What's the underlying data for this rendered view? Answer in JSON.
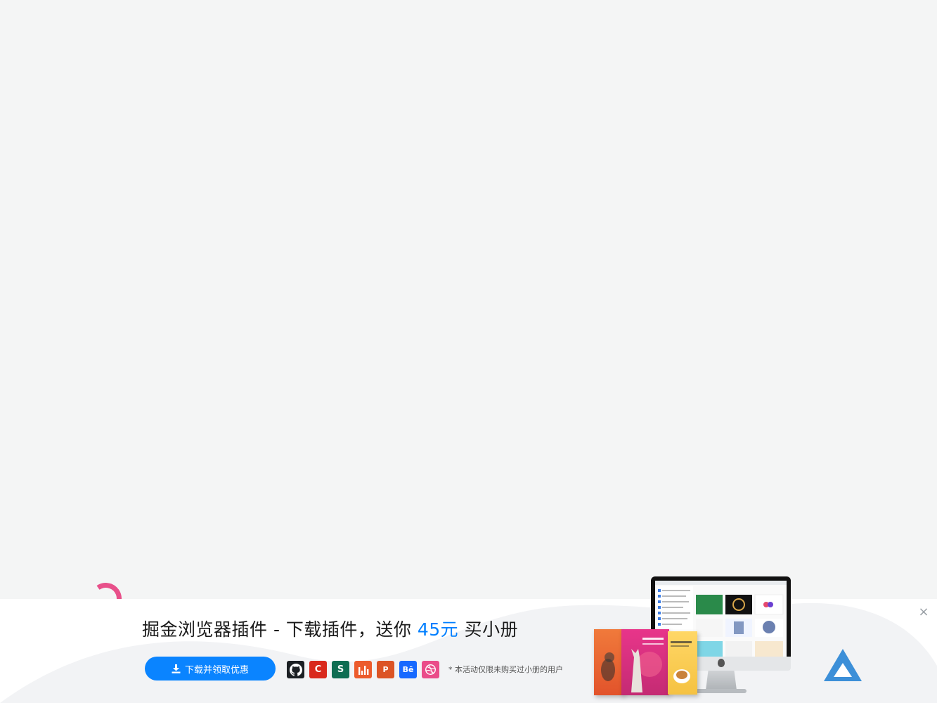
{
  "banner": {
    "headline_prefix": "掘金浏览器插件 - 下载插件，送你 ",
    "headline_amount": "45元",
    "headline_suffix": " 买小册",
    "download_button_label": "下载并领取优惠",
    "note": "* 本活动仅限未购买过小册的用户",
    "close_label": "×",
    "app_icons": [
      {
        "name": "github-icon",
        "glyph": ""
      },
      {
        "name": "csdn-icon",
        "glyph": "C"
      },
      {
        "name": "segmentfault-icon",
        "glyph": "S"
      },
      {
        "name": "chart-bars-icon",
        "glyph": ""
      },
      {
        "name": "producthunt-icon",
        "glyph": "P"
      },
      {
        "name": "behance-icon",
        "glyph": "Bē"
      },
      {
        "name": "dribbble-icon",
        "glyph": ""
      }
    ]
  },
  "colors": {
    "accent": "#007fff",
    "button": "#0a84ff",
    "spinner": "#e8508a",
    "page_bg": "#f4f5f5"
  }
}
